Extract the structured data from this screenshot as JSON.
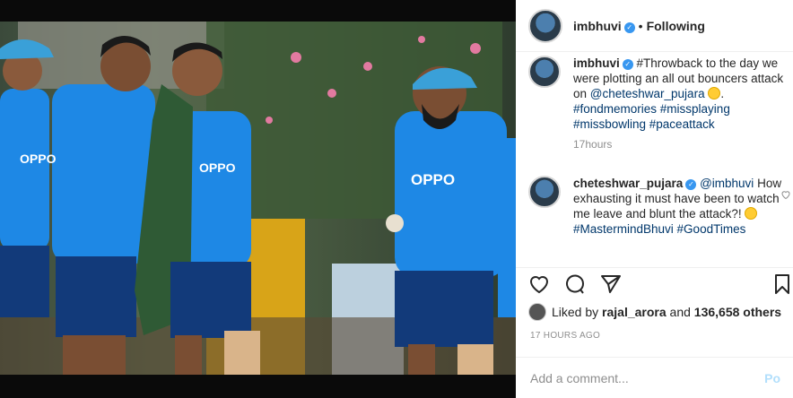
{
  "post": {
    "author": "imbhuvi",
    "follow_state": "Following",
    "dot": "•",
    "verified_mark": "✓"
  },
  "caption": {
    "author": "imbhuvi",
    "text_part1": "#Throwback to the day we were plotting an all out bouncers attack on",
    "mention": "@cheteshwar_pujara",
    "tags": "#fondmemories #missplaying #missbowling #paceattack",
    "time": "17hours"
  },
  "reply": {
    "author": "cheteshwar_pujara",
    "mention": "@imbhuvi",
    "text": "How exhausting it must have been to watch me leave and blunt the attack?!",
    "tags": "#MastermindBhuvi #GoodTimes"
  },
  "photo": {
    "jersey_text": "OPPO"
  },
  "likes": {
    "prefix": "Liked by",
    "user": "rajal_arora",
    "joiner": "and",
    "count": "136,658 others"
  },
  "timeago": "17 HOURS AGO",
  "add_comment": {
    "placeholder": "Add a comment...",
    "post_label": "Po"
  },
  "icons": {
    "like": "heart-icon",
    "comment": "comment-icon",
    "share": "share-icon",
    "save": "bookmark-icon"
  },
  "colors": {
    "jersey": "#1e88e5",
    "shorts": "#123a7a",
    "link": "#00376b",
    "verified": "#3897f0"
  }
}
